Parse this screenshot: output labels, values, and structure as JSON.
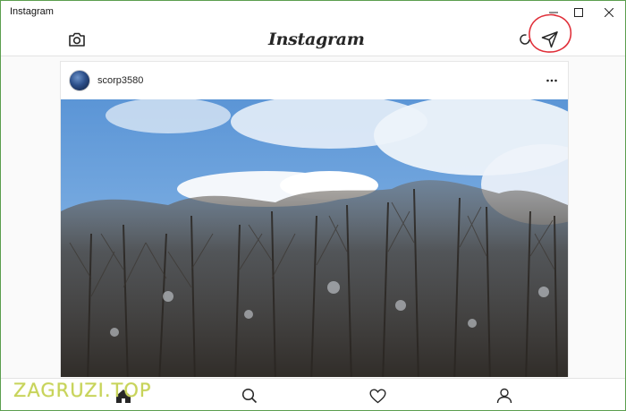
{
  "window": {
    "title": "Instagram"
  },
  "appbar": {
    "logo": "Instagram",
    "camera_icon": "camera-icon",
    "refresh_icon": "refresh-icon",
    "direct_icon": "paper-plane-icon"
  },
  "post": {
    "username": "scorp3580",
    "more_icon": "more-horizontal-icon",
    "photo": "snowy bare trees against blue sky"
  },
  "bottom_nav": {
    "items": [
      "home-icon",
      "search-icon",
      "heart-icon",
      "profile-icon"
    ]
  },
  "watermark": {
    "text": "ZAGRUZI.TOP"
  },
  "colors": {
    "border": "#5b9e4e",
    "highlight": "#e0303a",
    "watermark": "#c7d35a"
  }
}
